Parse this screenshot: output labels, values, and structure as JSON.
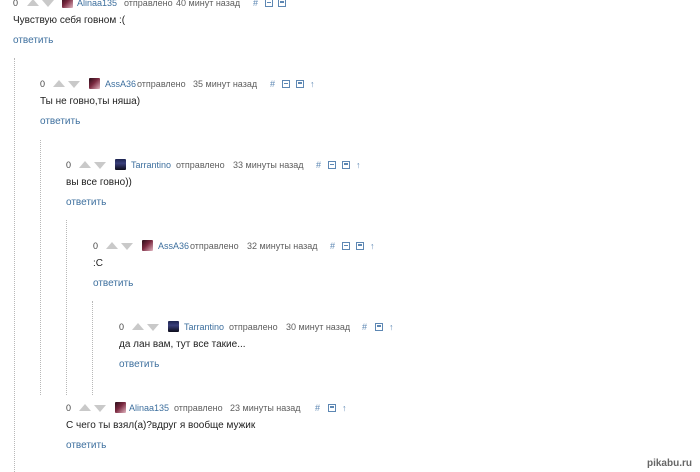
{
  "reply_label": "ответить",
  "sent_label": "отправлено",
  "icons": {
    "hash": "#",
    "collapse": "collapse-icon",
    "save": "save-icon",
    "up": "↑"
  },
  "comments": [
    {
      "rating": "0",
      "user": "Alinaa135",
      "time": "40 минут назад",
      "text": "Чувствую себя говном :("
    },
    {
      "rating": "0",
      "user": "AssA36",
      "time": "35 минут назад",
      "text": "Ты не говно,ты няша)"
    },
    {
      "rating": "0",
      "user": "Tarrantino",
      "time": "33 минуты назад",
      "text": "вы все говно))"
    },
    {
      "rating": "0",
      "user": "AssA36",
      "time": "32 минуты назад",
      "text": ":C"
    },
    {
      "rating": "0",
      "user": "Tarrantino",
      "time": "30 минут назад",
      "text": "да лан вам, тут все такие..."
    },
    {
      "rating": "0",
      "user": "Alinaa135",
      "time": "23 минуты назад",
      "text": "С чего ты взял(а)?вдруг я вообще мужик"
    }
  ],
  "watermark": "pikabu.ru"
}
